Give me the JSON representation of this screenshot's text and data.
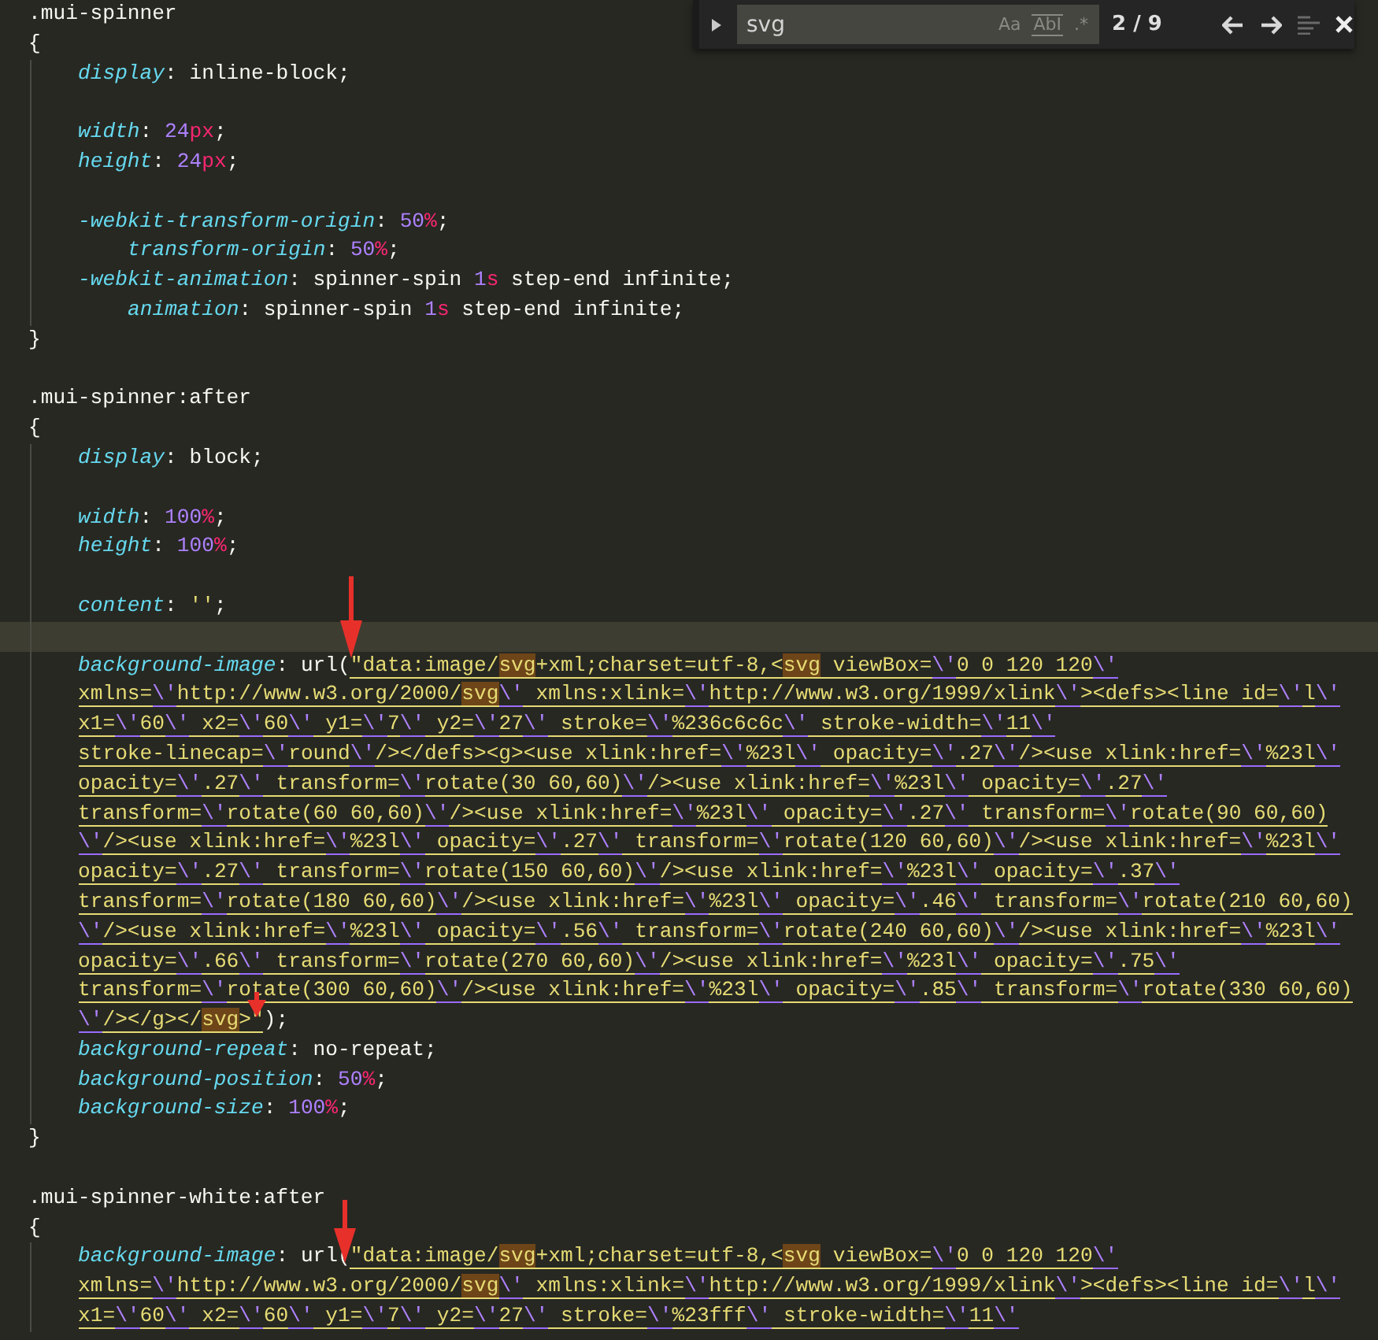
{
  "find_panel": {
    "query": "svg",
    "options": [
      {
        "label": "Aa",
        "on": false
      },
      {
        "label": "AbI",
        "on": false
      },
      {
        "label": ".*",
        "on": false
      }
    ],
    "count": "2 / 9"
  },
  "lines": [
    {
      "current": false,
      "indented": false,
      "tokens": [
        {
          "text": ".mui-spinner",
          "kind": "sel"
        }
      ]
    },
    {
      "current": false,
      "indented": false,
      "tokens": [
        {
          "text": "{",
          "kind": "punct"
        }
      ]
    },
    {
      "current": false,
      "indented": true,
      "tokens": [
        {
          "text": "display",
          "kind": "prop"
        },
        {
          "text": ": inline-block;",
          "kind": "punct"
        }
      ]
    },
    {
      "current": false,
      "indented": true
    },
    {
      "current": false,
      "indented": true,
      "tokens": [
        {
          "text": "width",
          "kind": "prop"
        },
        {
          "text": ": ",
          "kind": "punct"
        },
        {
          "text": "24",
          "kind": "num"
        },
        {
          "text": "px",
          "kind": "unit"
        },
        {
          "text": ";",
          "kind": "punct"
        }
      ]
    },
    {
      "current": false,
      "indented": true,
      "tokens": [
        {
          "text": "height",
          "kind": "prop"
        },
        {
          "text": ": ",
          "kind": "punct"
        },
        {
          "text": "24",
          "kind": "num"
        },
        {
          "text": "px",
          "kind": "unit"
        },
        {
          "text": ";",
          "kind": "punct"
        }
      ]
    },
    {
      "current": false,
      "indented": true
    },
    {
      "current": false,
      "indented": true,
      "tokens": [
        {
          "text": "-webkit-transform-origin",
          "kind": "prop"
        },
        {
          "text": ": ",
          "kind": "punct"
        },
        {
          "text": "50",
          "kind": "num"
        },
        {
          "text": "%",
          "kind": "unit"
        },
        {
          "text": ";",
          "kind": "punct"
        }
      ]
    },
    {
      "current": false,
      "indented": true,
      "tokens": [
        {
          "text": "transform-origin",
          "kind": "prop_aligned"
        },
        {
          "text": ": ",
          "kind": "punct"
        },
        {
          "text": "50",
          "kind": "num"
        },
        {
          "text": "%",
          "kind": "unit"
        },
        {
          "text": ";",
          "kind": "punct"
        }
      ]
    },
    {
      "current": false,
      "indented": true,
      "tokens": [
        {
          "text": "-webkit-animation",
          "kind": "prop"
        },
        {
          "text": ": spinner-spin ",
          "kind": "punct"
        },
        {
          "text": "1",
          "kind": "num"
        },
        {
          "text": "s",
          "kind": "unit"
        },
        {
          "text": " step-end infinite;",
          "kind": "punct"
        }
      ]
    },
    {
      "current": false,
      "indented": true,
      "tokens": [
        {
          "text": "animation",
          "kind": "prop_aligned"
        },
        {
          "text": ": spinner-spin ",
          "kind": "punct"
        },
        {
          "text": "1",
          "kind": "num"
        },
        {
          "text": "s",
          "kind": "unit"
        },
        {
          "text": " step-end infinite;",
          "kind": "punct"
        }
      ]
    },
    {
      "current": false,
      "indented": false,
      "tokens": [
        {
          "text": "}",
          "kind": "punct"
        }
      ]
    },
    {
      "current": false,
      "indented": false
    },
    {
      "current": false,
      "indented": false,
      "tokens": [
        {
          "text": ".mui-spinner:after",
          "kind": "sel"
        }
      ]
    },
    {
      "current": false,
      "indented": false,
      "tokens": [
        {
          "text": "{",
          "kind": "punct"
        }
      ]
    },
    {
      "current": false,
      "indented": true,
      "tokens": [
        {
          "text": "display",
          "kind": "prop"
        },
        {
          "text": ": block;",
          "kind": "punct"
        }
      ]
    },
    {
      "current": false,
      "indented": true
    },
    {
      "current": false,
      "indented": true,
      "tokens": [
        {
          "text": "width",
          "kind": "prop"
        },
        {
          "text": ": ",
          "kind": "punct"
        },
        {
          "text": "100",
          "kind": "num"
        },
        {
          "text": "%",
          "kind": "unit"
        },
        {
          "text": ";",
          "kind": "punct"
        }
      ]
    },
    {
      "current": false,
      "indented": true,
      "tokens": [
        {
          "text": "height",
          "kind": "prop"
        },
        {
          "text": ": ",
          "kind": "punct"
        },
        {
          "text": "100",
          "kind": "num"
        },
        {
          "text": "%",
          "kind": "unit"
        },
        {
          "text": ";",
          "kind": "punct"
        }
      ]
    },
    {
      "current": false,
      "indented": true
    },
    {
      "current": false,
      "indented": true,
      "tokens": [
        {
          "text": "content",
          "kind": "prop"
        },
        {
          "text": ": ",
          "kind": "punct"
        },
        {
          "text": "''",
          "kind": "plainstr"
        },
        {
          "text": ";",
          "kind": "punct"
        }
      ]
    },
    {
      "current": true,
      "indented": true
    },
    {
      "current": false,
      "indented": true,
      "tokens": [
        {
          "text": "background-image",
          "kind": "prop"
        },
        {
          "text": ": url(",
          "kind": "punct"
        },
        {
          "text": "\"data:image/",
          "kind": "str"
        },
        {
          "text": "svg",
          "kind": "match"
        },
        {
          "text": "+xml;charset=utf-8,<",
          "kind": "str"
        },
        {
          "text": "svg",
          "kind": "match"
        },
        {
          "text": " viewBox=",
          "kind": "str"
        },
        {
          "text": "\\'",
          "kind": "esc"
        },
        {
          "text": "0 0 120 120",
          "kind": "str"
        },
        {
          "text": "\\'",
          "kind": "esc"
        }
      ]
    },
    {
      "current": false,
      "indented": true,
      "tokens": [
        {
          "text": "xmlns=",
          "kind": "str"
        },
        {
          "text": "\\'",
          "kind": "esc"
        },
        {
          "text": "http://www.w3.org/2000/",
          "kind": "str"
        },
        {
          "text": "svg",
          "kind": "match"
        },
        {
          "text": "\\'",
          "kind": "esc"
        },
        {
          "text": " xmlns:xlink=",
          "kind": "str"
        },
        {
          "text": "\\'",
          "kind": "esc"
        },
        {
          "text": "http://www.w3.org/1999/xlink",
          "kind": "str"
        },
        {
          "text": "\\'",
          "kind": "esc"
        },
        {
          "text": "><defs><line id=",
          "kind": "str"
        },
        {
          "text": "\\'",
          "kind": "esc"
        },
        {
          "text": "l",
          "kind": "str"
        },
        {
          "text": "\\'",
          "kind": "esc"
        }
      ]
    },
    {
      "current": false,
      "indented": true,
      "tokens": [
        {
          "text": "x1=",
          "kind": "str"
        },
        {
          "text": "\\'",
          "kind": "esc"
        },
        {
          "text": "60",
          "kind": "str"
        },
        {
          "text": "\\'",
          "kind": "esc"
        },
        {
          "text": " x2=",
          "kind": "str"
        },
        {
          "text": "\\'",
          "kind": "esc"
        },
        {
          "text": "60",
          "kind": "str"
        },
        {
          "text": "\\'",
          "kind": "esc"
        },
        {
          "text": " y1=",
          "kind": "str"
        },
        {
          "text": "\\'",
          "kind": "esc"
        },
        {
          "text": "7",
          "kind": "str"
        },
        {
          "text": "\\'",
          "kind": "esc"
        },
        {
          "text": " y2=",
          "kind": "str"
        },
        {
          "text": "\\'",
          "kind": "esc"
        },
        {
          "text": "27",
          "kind": "str"
        },
        {
          "text": "\\'",
          "kind": "esc"
        },
        {
          "text": " stroke=",
          "kind": "str"
        },
        {
          "text": "\\'",
          "kind": "esc"
        },
        {
          "text": "%236c6c6c",
          "kind": "str"
        },
        {
          "text": "\\'",
          "kind": "esc"
        },
        {
          "text": " stroke-width=",
          "kind": "str"
        },
        {
          "text": "\\'",
          "kind": "esc"
        },
        {
          "text": "11",
          "kind": "str"
        },
        {
          "text": "\\'",
          "kind": "esc"
        }
      ]
    },
    {
      "current": false,
      "indented": true,
      "tokens": [
        {
          "text": "stroke-linecap=",
          "kind": "str"
        },
        {
          "text": "\\'",
          "kind": "esc"
        },
        {
          "text": "round",
          "kind": "str"
        },
        {
          "text": "\\'",
          "kind": "esc"
        },
        {
          "text": "/></defs><g><use xlink:href=",
          "kind": "str"
        },
        {
          "text": "\\'",
          "kind": "esc"
        },
        {
          "text": "%23l",
          "kind": "str"
        },
        {
          "text": "\\'",
          "kind": "esc"
        },
        {
          "text": " opacity=",
          "kind": "str"
        },
        {
          "text": "\\'",
          "kind": "esc"
        },
        {
          "text": ".27",
          "kind": "str"
        },
        {
          "text": "\\'",
          "kind": "esc"
        },
        {
          "text": "/><use xlink:href=",
          "kind": "str"
        },
        {
          "text": "\\'",
          "kind": "esc"
        },
        {
          "text": "%23l",
          "kind": "str"
        },
        {
          "text": "\\'",
          "kind": "esc"
        }
      ]
    },
    {
      "current": false,
      "indented": true,
      "tokens": [
        {
          "text": "opacity=",
          "kind": "str"
        },
        {
          "text": "\\'",
          "kind": "esc"
        },
        {
          "text": ".27",
          "kind": "str"
        },
        {
          "text": "\\'",
          "kind": "esc"
        },
        {
          "text": " transform=",
          "kind": "str"
        },
        {
          "text": "\\'",
          "kind": "esc"
        },
        {
          "text": "rotate(30 60,60)",
          "kind": "str"
        },
        {
          "text": "\\'",
          "kind": "esc"
        },
        {
          "text": "/><use xlink:href=",
          "kind": "str"
        },
        {
          "text": "\\'",
          "kind": "esc"
        },
        {
          "text": "%23l",
          "kind": "str"
        },
        {
          "text": "\\'",
          "kind": "esc"
        },
        {
          "text": " opacity=",
          "kind": "str"
        },
        {
          "text": "\\'",
          "kind": "esc"
        },
        {
          "text": ".27",
          "kind": "str"
        },
        {
          "text": "\\'",
          "kind": "esc"
        }
      ]
    },
    {
      "current": false,
      "indented": true,
      "tokens": [
        {
          "text": "transform=",
          "kind": "str"
        },
        {
          "text": "\\'",
          "kind": "esc"
        },
        {
          "text": "rotate(60 60,60)",
          "kind": "str"
        },
        {
          "text": "\\'",
          "kind": "esc"
        },
        {
          "text": "/><use xlink:href=",
          "kind": "str"
        },
        {
          "text": "\\'",
          "kind": "esc"
        },
        {
          "text": "%23l",
          "kind": "str"
        },
        {
          "text": "\\'",
          "kind": "esc"
        },
        {
          "text": " opacity=",
          "kind": "str"
        },
        {
          "text": "\\'",
          "kind": "esc"
        },
        {
          "text": ".27",
          "kind": "str"
        },
        {
          "text": "\\'",
          "kind": "esc"
        },
        {
          "text": " transform=",
          "kind": "str"
        },
        {
          "text": "\\'",
          "kind": "esc"
        },
        {
          "text": "rotate(90 60,60)",
          "kind": "str"
        }
      ]
    },
    {
      "current": false,
      "indented": true,
      "tokens": [
        {
          "text": "\\'",
          "kind": "esc"
        },
        {
          "text": "/><use xlink:href=",
          "kind": "str"
        },
        {
          "text": "\\'",
          "kind": "esc"
        },
        {
          "text": "%23l",
          "kind": "str"
        },
        {
          "text": "\\'",
          "kind": "esc"
        },
        {
          "text": " opacity=",
          "kind": "str"
        },
        {
          "text": "\\'",
          "kind": "esc"
        },
        {
          "text": ".27",
          "kind": "str"
        },
        {
          "text": "\\'",
          "kind": "esc"
        },
        {
          "text": " transform=",
          "kind": "str"
        },
        {
          "text": "\\'",
          "kind": "esc"
        },
        {
          "text": "rotate(120 60,60)",
          "kind": "str"
        },
        {
          "text": "\\'",
          "kind": "esc"
        },
        {
          "text": "/><use xlink:href=",
          "kind": "str"
        },
        {
          "text": "\\'",
          "kind": "esc"
        },
        {
          "text": "%23l",
          "kind": "str"
        },
        {
          "text": "\\'",
          "kind": "esc"
        }
      ]
    },
    {
      "current": false,
      "indented": true,
      "tokens": [
        {
          "text": "opacity=",
          "kind": "str"
        },
        {
          "text": "\\'",
          "kind": "esc"
        },
        {
          "text": ".27",
          "kind": "str"
        },
        {
          "text": "\\'",
          "kind": "esc"
        },
        {
          "text": " transform=",
          "kind": "str"
        },
        {
          "text": "\\'",
          "kind": "esc"
        },
        {
          "text": "rotate(150 60,60)",
          "kind": "str"
        },
        {
          "text": "\\'",
          "kind": "esc"
        },
        {
          "text": "/><use xlink:href=",
          "kind": "str"
        },
        {
          "text": "\\'",
          "kind": "esc"
        },
        {
          "text": "%23l",
          "kind": "str"
        },
        {
          "text": "\\'",
          "kind": "esc"
        },
        {
          "text": " opacity=",
          "kind": "str"
        },
        {
          "text": "\\'",
          "kind": "esc"
        },
        {
          "text": ".37",
          "kind": "str"
        },
        {
          "text": "\\'",
          "kind": "esc"
        }
      ]
    },
    {
      "current": false,
      "indented": true,
      "tokens": [
        {
          "text": "transform=",
          "kind": "str"
        },
        {
          "text": "\\'",
          "kind": "esc"
        },
        {
          "text": "rotate(180 60,60)",
          "kind": "str"
        },
        {
          "text": "\\'",
          "kind": "esc"
        },
        {
          "text": "/><use xlink:href=",
          "kind": "str"
        },
        {
          "text": "\\'",
          "kind": "esc"
        },
        {
          "text": "%23l",
          "kind": "str"
        },
        {
          "text": "\\'",
          "kind": "esc"
        },
        {
          "text": " opacity=",
          "kind": "str"
        },
        {
          "text": "\\'",
          "kind": "esc"
        },
        {
          "text": ".46",
          "kind": "str"
        },
        {
          "text": "\\'",
          "kind": "esc"
        },
        {
          "text": " transform=",
          "kind": "str"
        },
        {
          "text": "\\'",
          "kind": "esc"
        },
        {
          "text": "rotate(210 60,60)",
          "kind": "str"
        }
      ]
    },
    {
      "current": false,
      "indented": true,
      "tokens": [
        {
          "text": "\\'",
          "kind": "esc"
        },
        {
          "text": "/><use xlink:href=",
          "kind": "str"
        },
        {
          "text": "\\'",
          "kind": "esc"
        },
        {
          "text": "%23l",
          "kind": "str"
        },
        {
          "text": "\\'",
          "kind": "esc"
        },
        {
          "text": " opacity=",
          "kind": "str"
        },
        {
          "text": "\\'",
          "kind": "esc"
        },
        {
          "text": ".56",
          "kind": "str"
        },
        {
          "text": "\\'",
          "kind": "esc"
        },
        {
          "text": " transform=",
          "kind": "str"
        },
        {
          "text": "\\'",
          "kind": "esc"
        },
        {
          "text": "rotate(240 60,60)",
          "kind": "str"
        },
        {
          "text": "\\'",
          "kind": "esc"
        },
        {
          "text": "/><use xlink:href=",
          "kind": "str"
        },
        {
          "text": "\\'",
          "kind": "esc"
        },
        {
          "text": "%23l",
          "kind": "str"
        },
        {
          "text": "\\'",
          "kind": "esc"
        }
      ]
    },
    {
      "current": false,
      "indented": true,
      "tokens": [
        {
          "text": "opacity=",
          "kind": "str"
        },
        {
          "text": "\\'",
          "kind": "esc"
        },
        {
          "text": ".66",
          "kind": "str"
        },
        {
          "text": "\\'",
          "kind": "esc"
        },
        {
          "text": " transform=",
          "kind": "str"
        },
        {
          "text": "\\'",
          "kind": "esc"
        },
        {
          "text": "rotate(270 60,60)",
          "kind": "str"
        },
        {
          "text": "\\'",
          "kind": "esc"
        },
        {
          "text": "/><use xlink:href=",
          "kind": "str"
        },
        {
          "text": "\\'",
          "kind": "esc"
        },
        {
          "text": "%23l",
          "kind": "str"
        },
        {
          "text": "\\'",
          "kind": "esc"
        },
        {
          "text": " opacity=",
          "kind": "str"
        },
        {
          "text": "\\'",
          "kind": "esc"
        },
        {
          "text": ".75",
          "kind": "str"
        },
        {
          "text": "\\'",
          "kind": "esc"
        }
      ]
    },
    {
      "current": false,
      "indented": true,
      "tokens": [
        {
          "text": "transform=",
          "kind": "str"
        },
        {
          "text": "\\'",
          "kind": "esc"
        },
        {
          "text": "rotate(300 60,60)",
          "kind": "str"
        },
        {
          "text": "\\'",
          "kind": "esc"
        },
        {
          "text": "/><use xlink:href=",
          "kind": "str"
        },
        {
          "text": "\\'",
          "kind": "esc"
        },
        {
          "text": "%23l",
          "kind": "str"
        },
        {
          "text": "\\'",
          "kind": "esc"
        },
        {
          "text": " opacity=",
          "kind": "str"
        },
        {
          "text": "\\'",
          "kind": "esc"
        },
        {
          "text": ".85",
          "kind": "str"
        },
        {
          "text": "\\'",
          "kind": "esc"
        },
        {
          "text": " transform=",
          "kind": "str"
        },
        {
          "text": "\\'",
          "kind": "esc"
        },
        {
          "text": "rotate(330 60,60)",
          "kind": "str"
        }
      ]
    },
    {
      "current": false,
      "indented": true,
      "tokens": [
        {
          "text": "\\'",
          "kind": "esc"
        },
        {
          "text": "/></g></",
          "kind": "str"
        },
        {
          "text": "svg",
          "kind": "match"
        },
        {
          "text": ">\"",
          "kind": "str"
        },
        {
          "text": ");",
          "kind": "punct"
        }
      ]
    },
    {
      "current": false,
      "indented": true,
      "tokens": [
        {
          "text": "background-repeat",
          "kind": "prop"
        },
        {
          "text": ": no-repeat;",
          "kind": "punct"
        }
      ]
    },
    {
      "current": false,
      "indented": true,
      "tokens": [
        {
          "text": "background-position",
          "kind": "prop"
        },
        {
          "text": ": ",
          "kind": "punct"
        },
        {
          "text": "50",
          "kind": "num"
        },
        {
          "text": "%",
          "kind": "unit"
        },
        {
          "text": ";",
          "kind": "punct"
        }
      ]
    },
    {
      "current": false,
      "indented": true,
      "tokens": [
        {
          "text": "background-size",
          "kind": "prop"
        },
        {
          "text": ": ",
          "kind": "punct"
        },
        {
          "text": "100",
          "kind": "num"
        },
        {
          "text": "%",
          "kind": "unit"
        },
        {
          "text": ";",
          "kind": "punct"
        }
      ]
    },
    {
      "current": false,
      "indented": false,
      "tokens": [
        {
          "text": "}",
          "kind": "punct"
        }
      ]
    },
    {
      "current": false,
      "indented": false
    },
    {
      "current": false,
      "indented": false,
      "tokens": [
        {
          "text": ".mui-spinner-white:after",
          "kind": "sel"
        }
      ]
    },
    {
      "current": false,
      "indented": false,
      "tokens": [
        {
          "text": "{",
          "kind": "punct"
        }
      ]
    },
    {
      "current": false,
      "indented": true,
      "tokens": [
        {
          "text": "background-image",
          "kind": "prop"
        },
        {
          "text": ": url(",
          "kind": "punct"
        },
        {
          "text": "\"data:image/",
          "kind": "str"
        },
        {
          "text": "svg",
          "kind": "match"
        },
        {
          "text": "+xml;charset=utf-8,<",
          "kind": "str"
        },
        {
          "text": "svg",
          "kind": "match"
        },
        {
          "text": " viewBox=",
          "kind": "str"
        },
        {
          "text": "\\'",
          "kind": "esc"
        },
        {
          "text": "0 0 120 120",
          "kind": "str"
        },
        {
          "text": "\\'",
          "kind": "esc"
        }
      ]
    },
    {
      "current": false,
      "indented": true,
      "tokens": [
        {
          "text": "xmlns=",
          "kind": "str"
        },
        {
          "text": "\\'",
          "kind": "esc"
        },
        {
          "text": "http://www.w3.org/2000/",
          "kind": "str"
        },
        {
          "text": "svg",
          "kind": "match"
        },
        {
          "text": "\\'",
          "kind": "esc"
        },
        {
          "text": " xmlns:xlink=",
          "kind": "str"
        },
        {
          "text": "\\'",
          "kind": "esc"
        },
        {
          "text": "http://www.w3.org/1999/xlink",
          "kind": "str"
        },
        {
          "text": "\\'",
          "kind": "esc"
        },
        {
          "text": "><defs><line id=",
          "kind": "str"
        },
        {
          "text": "\\'",
          "kind": "esc"
        },
        {
          "text": "l",
          "kind": "str"
        },
        {
          "text": "\\'",
          "kind": "esc"
        }
      ]
    },
    {
      "current": false,
      "indented": true,
      "tokens": [
        {
          "text": "x1=",
          "kind": "str"
        },
        {
          "text": "\\'",
          "kind": "esc"
        },
        {
          "text": "60",
          "kind": "str"
        },
        {
          "text": "\\'",
          "kind": "esc"
        },
        {
          "text": " x2=",
          "kind": "str"
        },
        {
          "text": "\\'",
          "kind": "esc"
        },
        {
          "text": "60",
          "kind": "str"
        },
        {
          "text": "\\'",
          "kind": "esc"
        },
        {
          "text": " y1=",
          "kind": "str"
        },
        {
          "text": "\\'",
          "kind": "esc"
        },
        {
          "text": "7",
          "kind": "str"
        },
        {
          "text": "\\'",
          "kind": "esc"
        },
        {
          "text": " y2=",
          "kind": "str"
        },
        {
          "text": "\\'",
          "kind": "esc"
        },
        {
          "text": "27",
          "kind": "str"
        },
        {
          "text": "\\'",
          "kind": "esc"
        },
        {
          "text": " stroke=",
          "kind": "str"
        },
        {
          "text": "\\'",
          "kind": "esc"
        },
        {
          "text": "%23fff",
          "kind": "str"
        },
        {
          "text": "\\'",
          "kind": "esc"
        },
        {
          "text": " stroke-width=",
          "kind": "str"
        },
        {
          "text": "\\'",
          "kind": "esc"
        },
        {
          "text": "11",
          "kind": "str"
        },
        {
          "text": "\\'",
          "kind": "esc"
        }
      ]
    }
  ]
}
